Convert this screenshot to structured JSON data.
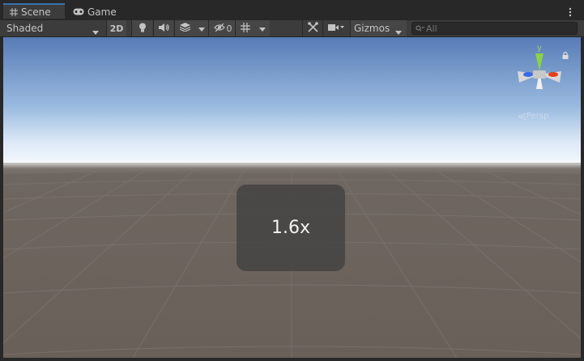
{
  "tabs": [
    {
      "label": "Scene",
      "icon": "grid-icon",
      "active": true
    },
    {
      "label": "Game",
      "icon": "gamepad-icon",
      "active": false
    }
  ],
  "toolbar": {
    "draw_mode": "Shaded",
    "mode_2d": "2D",
    "hidden_count": "0",
    "gizmos_label": "Gizmos",
    "search_placeholder": "All"
  },
  "viewport": {
    "zoom_text": "1.6x",
    "axis_label": "y",
    "projection_label": "Persp"
  },
  "colors": {
    "accent": "#3a72b0",
    "sky_top": "#5a80b8",
    "horizon": "#f0f6fc",
    "ground": "#6a605a",
    "axis_y": "#80d040",
    "axis_x": "#e04020",
    "axis_z": "#3060e0"
  }
}
